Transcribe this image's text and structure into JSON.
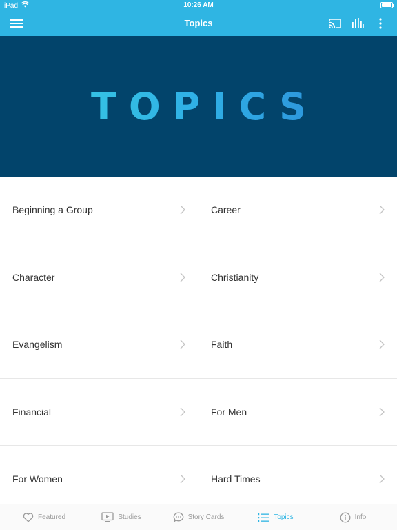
{
  "status_bar": {
    "device": "iPad",
    "time": "10:26 AM"
  },
  "nav_bar": {
    "title": "Topics",
    "icons": [
      "menu-icon",
      "cast-icon",
      "audio-bars-icon",
      "more-vertical-icon"
    ]
  },
  "hero": {
    "text": "TOPICS"
  },
  "topics": [
    {
      "label": "Beginning a Group"
    },
    {
      "label": "Career"
    },
    {
      "label": "Character"
    },
    {
      "label": "Christianity"
    },
    {
      "label": "Evangelism"
    },
    {
      "label": "Faith"
    },
    {
      "label": "Financial"
    },
    {
      "label": "For Men"
    },
    {
      "label": "For Women"
    },
    {
      "label": "Hard Times"
    }
  ],
  "tab_bar": {
    "tabs": [
      {
        "label": "Featured",
        "icon": "heart-icon"
      },
      {
        "label": "Studies",
        "icon": "play-screen-icon"
      },
      {
        "label": "Story Cards",
        "icon": "chat-bubble-icon"
      },
      {
        "label": "Topics",
        "icon": "list-icon",
        "active": true
      },
      {
        "label": "Info",
        "icon": "info-icon"
      }
    ]
  },
  "colors": {
    "accent": "#2fb5e3",
    "hero_bg": "#02446b",
    "text": "#333333",
    "tab_inactive": "#9a9a9a"
  }
}
